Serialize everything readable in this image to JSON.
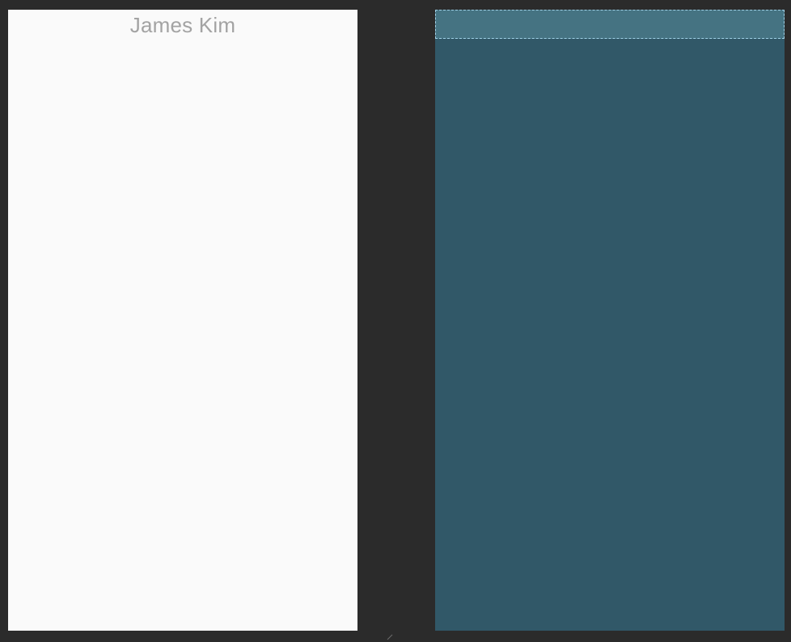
{
  "design_preview": {
    "textview_text": "James Kim",
    "background_color": "#fafafa",
    "text_color": "#a3a3a3"
  },
  "blueprint": {
    "background_color": "#315868",
    "selected_view_color": "#457382",
    "selection_outline_color": "#9fd0e6"
  },
  "canvas": {
    "background_color": "#2b2b2b"
  }
}
